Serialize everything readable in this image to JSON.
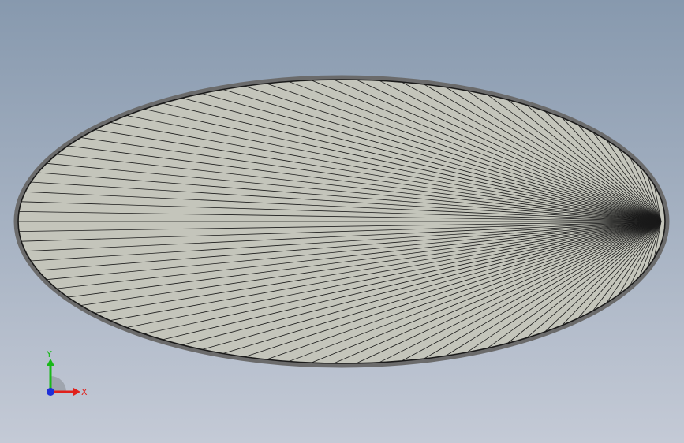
{
  "viewport": {
    "background_top": "#8799ae",
    "background_bottom": "#c4cad6"
  },
  "model": {
    "face_color": "#c4c5bb",
    "edge_color": "#1a1a1a",
    "rim_color": "#6b6b6b"
  },
  "triad": {
    "x_label": "X",
    "y_label": "Y",
    "x_color": "#e0201b",
    "y_color": "#18b818",
    "z_color": "#1f2fd8"
  }
}
